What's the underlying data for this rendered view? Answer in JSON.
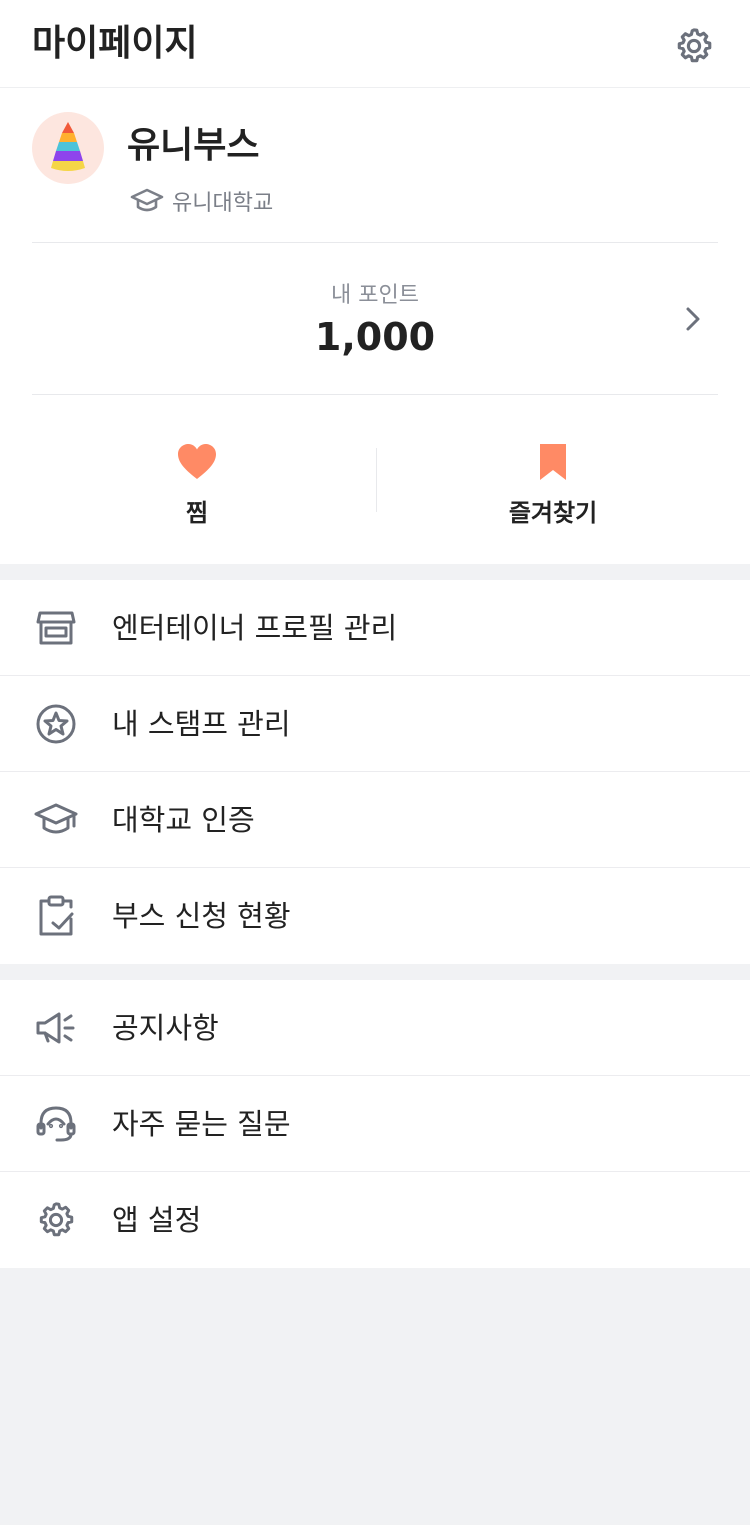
{
  "header": {
    "title": "마이페이지",
    "settings_icon": "gear-icon"
  },
  "profile": {
    "avatar_icon": "party-hat-icon",
    "name": "유니부스",
    "school_icon": "graduation-cap-icon",
    "school": "유니대학교"
  },
  "points": {
    "label": "내 포인트",
    "value": "1,000",
    "chevron_icon": "chevron-right-icon"
  },
  "quick_actions": [
    {
      "label": "찜",
      "icon": "heart-icon",
      "color": "#ff8a65"
    },
    {
      "label": "즐겨찾기",
      "icon": "bookmark-icon",
      "color": "#ff8a65"
    }
  ],
  "menu_group_1": [
    {
      "label": "엔터테이너 프로필 관리",
      "icon": "storefront-icon"
    },
    {
      "label": "내 스탬프 관리",
      "icon": "star-badge-icon"
    },
    {
      "label": "대학교 인증",
      "icon": "graduation-cap-icon"
    },
    {
      "label": "부스 신청 현황",
      "icon": "clipboard-check-icon"
    }
  ],
  "menu_group_2": [
    {
      "label": "공지사항",
      "icon": "megaphone-icon"
    },
    {
      "label": "자주 묻는 질문",
      "icon": "headset-icon"
    },
    {
      "label": "앱 설정",
      "icon": "gear-icon"
    }
  ],
  "colors": {
    "accent": "#ff8a65",
    "icon_gray": "#6c717c",
    "background": "#f1f2f4"
  }
}
